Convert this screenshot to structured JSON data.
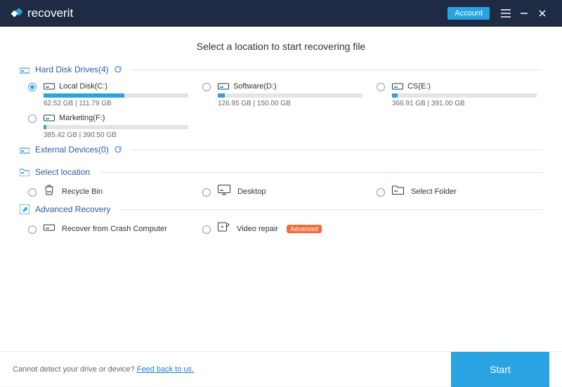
{
  "brand": "recoverit",
  "header": {
    "account_label": "Account"
  },
  "title": "Select a location to start recovering file",
  "sections": {
    "hdd": {
      "label": "Hard Disk Drives(4)"
    },
    "ext": {
      "label": "External Devices(0)"
    },
    "loc": {
      "label": "Select location"
    },
    "adv": {
      "label": "Advanced Recovery"
    }
  },
  "drives": [
    {
      "name": "Local Disk(C:)",
      "used": "62.52  GB",
      "total": "111.79  GB",
      "pct": 56,
      "selected": true
    },
    {
      "name": "Software(D:)",
      "used": "126.95  GB",
      "total": "150.00  GB",
      "pct": 5,
      "selected": false
    },
    {
      "name": "CS(E:)",
      "used": "366.91  GB",
      "total": "391.00  GB",
      "pct": 4,
      "selected": false
    },
    {
      "name": "Marketing(F:)",
      "used": "385.42  GB",
      "total": "390.50  GB",
      "pct": 2,
      "selected": false
    }
  ],
  "locations": [
    {
      "name": "Recycle Bin",
      "icon": "recycle-bin-icon"
    },
    {
      "name": "Desktop",
      "icon": "desktop-icon"
    },
    {
      "name": "Select Folder",
      "icon": "folder-icon"
    }
  ],
  "advanced": [
    {
      "name": "Recover from Crash Computer",
      "icon": "drive-icon",
      "badge": null
    },
    {
      "name": "Video repair",
      "icon": "video-repair-icon",
      "badge": "Advanced"
    }
  ],
  "footer": {
    "text": "Cannot detect your drive or device? ",
    "link": "Feed back to us.",
    "start": "Start"
  },
  "colors": {
    "accent": "#2aa3e2",
    "header": "#1f2a44",
    "badge": "#f26b3a"
  }
}
